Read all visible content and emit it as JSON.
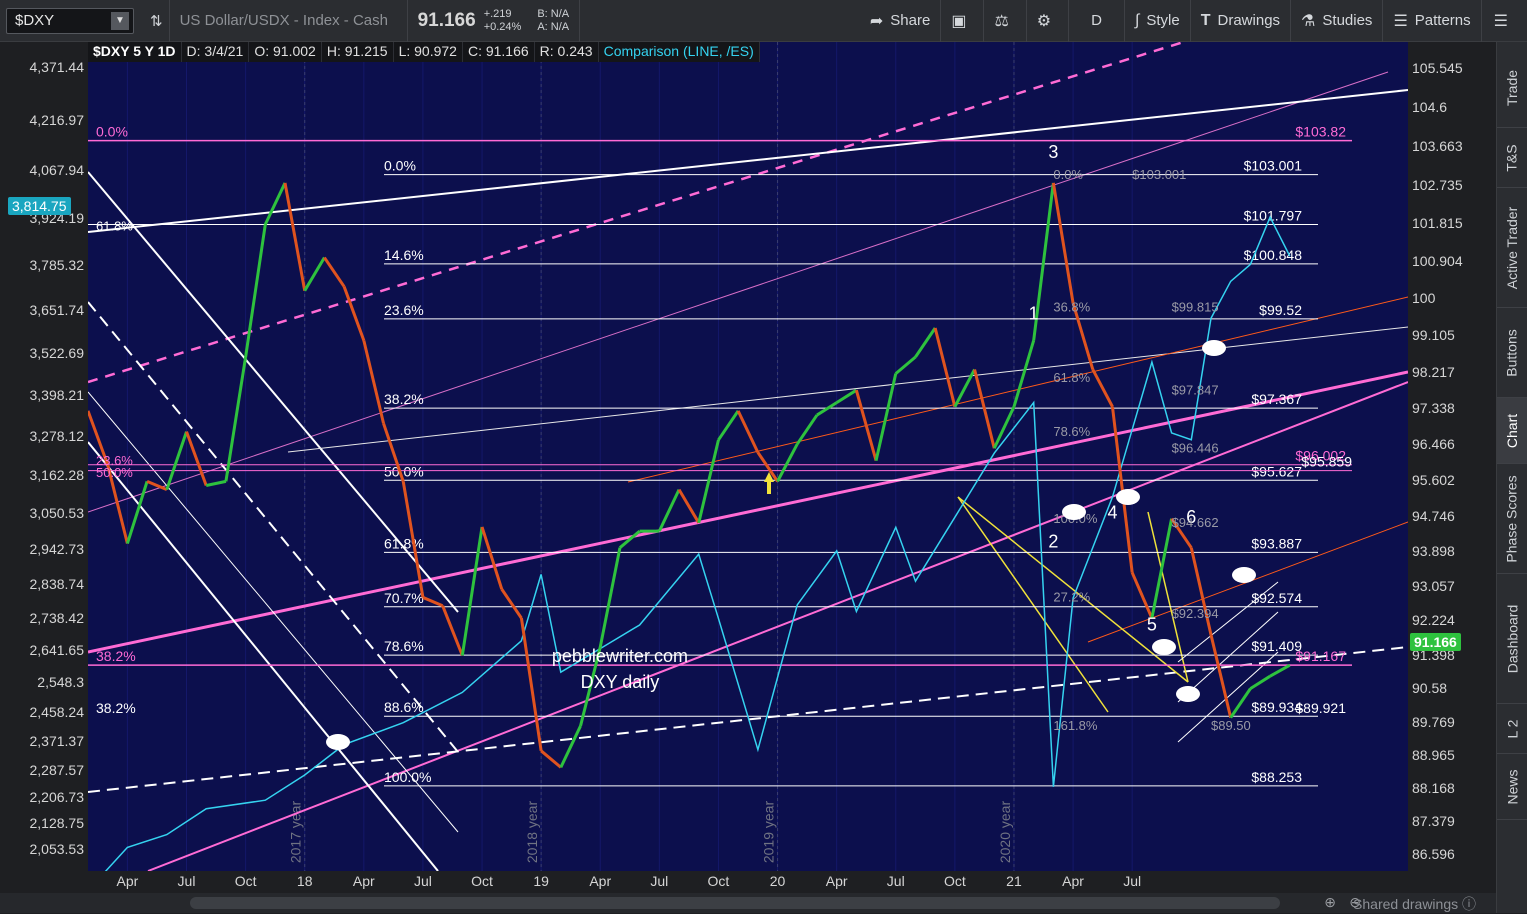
{
  "toolbar": {
    "symbol": "$DXY",
    "description": "US Dollar/USDX - Index - Cash",
    "last": "91.166",
    "change": "+.219",
    "change_pct": "+0.24%",
    "bid": "B: N/A",
    "ask": "A: N/A",
    "share_label": "Share",
    "period_label": "D",
    "style_label": "Style",
    "drawings_label": "Drawings",
    "studies_label": "Studies",
    "patterns_label": "Patterns"
  },
  "header": {
    "symbol": "$DXY 5 Y 1D",
    "date": "D: 3/4/21",
    "open": "O: 91.002",
    "high": "H: 91.215",
    "low": "L: 90.972",
    "close": "C: 91.166",
    "range": "R: 0.243",
    "comparison": "Comparison (LINE, /ES)"
  },
  "side_tabs": [
    "Trade",
    "T&S",
    "Active Trader",
    "Buttons",
    "Chart",
    "Phase Scores",
    "Dashboard",
    "L 2",
    "News"
  ],
  "footer": {
    "shared_drawings": "Shared drawings"
  },
  "current": {
    "left": "3,814.75",
    "right": "91.166"
  },
  "colors": {
    "background": "#0c0f4d",
    "comparison": "#35d3f0",
    "fib_pink": "#ff6bd5",
    "up": "#2ec23e",
    "down": "#e0531f"
  },
  "chart_data": {
    "type": "line",
    "title": "DXY daily",
    "watermark": "pebblewriter.com",
    "x_ticks": [
      "Apr",
      "Jul",
      "Oct",
      "18",
      "Apr",
      "Jul",
      "Oct",
      "19",
      "Apr",
      "Jul",
      "Oct",
      "20",
      "Apr",
      "Jul",
      "Oct",
      "21",
      "Apr",
      "Jul"
    ],
    "year_labels": [
      "2017 year",
      "2018 year",
      "2019 year",
      "2020 year"
    ],
    "y_right_ticks": [
      "105.545",
      "104.6",
      "103.663",
      "102.735",
      "101.815",
      "100.904",
      "100",
      "99.105",
      "98.217",
      "97.338",
      "96.466",
      "95.602",
      "94.746",
      "93.898",
      "93.057",
      "92.224",
      "91.398",
      "90.58",
      "89.769",
      "88.965",
      "88.168",
      "87.379",
      "86.596"
    ],
    "y_left_ticks": [
      "4,371.44",
      "4,216.97",
      "4,067.94",
      "3,924.19",
      "3,785.32",
      "3,651.74",
      "3,522.69",
      "3,398.21",
      "3,278.12",
      "3,162.28",
      "3,050.53",
      "2,942.73",
      "2,838.74",
      "2,738.42",
      "2,641.65",
      "2,548.3",
      "2,458.24",
      "2,371.37",
      "2,287.57",
      "2,206.73",
      "2,128.75",
      "2,053.53"
    ],
    "ylim_right": [
      86.2,
      106.2
    ],
    "series": [
      {
        "name": "$DXY",
        "axis": "right",
        "points": [
          [
            "2016-02",
            97.3
          ],
          [
            "2016-03",
            96.0
          ],
          [
            "2016-04",
            94.1
          ],
          [
            "2016-05",
            95.6
          ],
          [
            "2016-06",
            95.4
          ],
          [
            "2016-07",
            96.8
          ],
          [
            "2016-08",
            95.5
          ],
          [
            "2016-09",
            95.6
          ],
          [
            "2016-10",
            98.6
          ],
          [
            "2016-11",
            101.8
          ],
          [
            "2016-12",
            102.8
          ],
          [
            "2017-01",
            100.2
          ],
          [
            "2017-02",
            101.0
          ],
          [
            "2017-03",
            100.3
          ],
          [
            "2017-04",
            99.0
          ],
          [
            "2017-05",
            97.0
          ],
          [
            "2017-06",
            95.6
          ],
          [
            "2017-07",
            92.8
          ],
          [
            "2017-08",
            92.6
          ],
          [
            "2017-09",
            91.4
          ],
          [
            "2017-10",
            94.5
          ],
          [
            "2017-11",
            93.0
          ],
          [
            "2017-12",
            92.3
          ],
          [
            "2018-01",
            89.1
          ],
          [
            "2018-02",
            88.7
          ],
          [
            "2018-03",
            89.7
          ],
          [
            "2018-04",
            91.6
          ],
          [
            "2018-05",
            94.0
          ],
          [
            "2018-06",
            94.4
          ],
          [
            "2018-07",
            94.4
          ],
          [
            "2018-08",
            95.4
          ],
          [
            "2018-09",
            94.6
          ],
          [
            "2018-10",
            96.6
          ],
          [
            "2018-11",
            97.3
          ],
          [
            "2018-12",
            96.3
          ],
          [
            "2019-01",
            95.6
          ],
          [
            "2019-02",
            96.5
          ],
          [
            "2019-03",
            97.2
          ],
          [
            "2019-04",
            97.5
          ],
          [
            "2019-05",
            97.8
          ],
          [
            "2019-06",
            96.1
          ],
          [
            "2019-07",
            98.2
          ],
          [
            "2019-08",
            98.6
          ],
          [
            "2019-09",
            99.3
          ],
          [
            "2019-10",
            97.4
          ],
          [
            "2019-11",
            98.3
          ],
          [
            "2019-12",
            96.4
          ],
          [
            "2020-01",
            97.4
          ],
          [
            "2020-02",
            99.0
          ],
          [
            "2020-03",
            102.8
          ],
          [
            "2020-04",
            99.9
          ],
          [
            "2020-05",
            98.3
          ],
          [
            "2020-06",
            97.4
          ],
          [
            "2020-07",
            93.4
          ],
          [
            "2020-08",
            92.3
          ],
          [
            "2020-09",
            94.7
          ],
          [
            "2020-10",
            94.0
          ],
          [
            "2020-11",
            91.9
          ],
          [
            "2020-12",
            89.9
          ],
          [
            "2021-01",
            90.6
          ],
          [
            "2021-02",
            90.9
          ],
          [
            "2021-03",
            91.166
          ]
        ]
      },
      {
        "name": "/ES",
        "axis": "left",
        "points": [
          [
            "2016-02",
            1932
          ],
          [
            "2016-04",
            2060
          ],
          [
            "2016-06",
            2098
          ],
          [
            "2016-08",
            2175
          ],
          [
            "2016-11",
            2200
          ],
          [
            "2017-01",
            2275
          ],
          [
            "2017-03",
            2365
          ],
          [
            "2017-06",
            2430
          ],
          [
            "2017-09",
            2520
          ],
          [
            "2017-12",
            2673
          ],
          [
            "2018-01",
            2870
          ],
          [
            "2018-02",
            2580
          ],
          [
            "2018-04",
            2650
          ],
          [
            "2018-06",
            2720
          ],
          [
            "2018-09",
            2930
          ],
          [
            "2018-10",
            2740
          ],
          [
            "2018-12",
            2350
          ],
          [
            "2019-02",
            2780
          ],
          [
            "2019-04",
            2940
          ],
          [
            "2019-05",
            2760
          ],
          [
            "2019-07",
            3010
          ],
          [
            "2019-08",
            2850
          ],
          [
            "2019-10",
            3040
          ],
          [
            "2019-12",
            3230
          ],
          [
            "2020-02",
            3380
          ],
          [
            "2020-03",
            2240
          ],
          [
            "2020-04",
            2800
          ],
          [
            "2020-06",
            3100
          ],
          [
            "2020-08",
            3500
          ],
          [
            "2020-09",
            3290
          ],
          [
            "2020-10",
            3270
          ],
          [
            "2020-11",
            3630
          ],
          [
            "2020-12",
            3740
          ],
          [
            "2021-01",
            3790
          ],
          [
            "2021-02",
            3930
          ],
          [
            "2021-03",
            3814.75
          ]
        ]
      }
    ],
    "fib_levels": [
      {
        "label": "0.0%",
        "value": "$103.001"
      },
      {
        "label": "",
        "value": "$101.797"
      },
      {
        "label": "14.6%",
        "value": "$100.848"
      },
      {
        "label": "23.6%",
        "value": "$99.52"
      },
      {
        "label": "38.2%",
        "value": "$97.367"
      },
      {
        "label": "50.0%",
        "value": "$95.627"
      },
      {
        "label": "61.8%",
        "value": "$93.887"
      },
      {
        "label": "70.7%",
        "value": "$92.574"
      },
      {
        "label": "78.6%",
        "value": "$91.409"
      },
      {
        "label": "88.6%",
        "value": "$89.934"
      },
      {
        "label": "100.0%",
        "value": "$88.253"
      }
    ],
    "pink_levels": [
      {
        "label": "0.0%",
        "value": "$103.82"
      },
      {
        "label": "38.2%",
        "value": "$91.167"
      },
      {
        "label": "",
        "value": "$96.002"
      },
      {
        "label": "",
        "value": "$95.859"
      },
      {
        "label": "38.2%",
        "value": "$89.921"
      }
    ],
    "small_labels": [
      "61.8%",
      "50.0%",
      "23.6%",
      "0.0%",
      "$103.001",
      "36.8%",
      "61.8%",
      "78.6%",
      "100.0%",
      "27.2%",
      "161.8%",
      "$99.815",
      "$97.847",
      "$96.446",
      "$94.662",
      "$92.394",
      "$89.50"
    ],
    "wave_labels": [
      "1",
      "2",
      "3",
      "4",
      "5",
      "6"
    ]
  }
}
